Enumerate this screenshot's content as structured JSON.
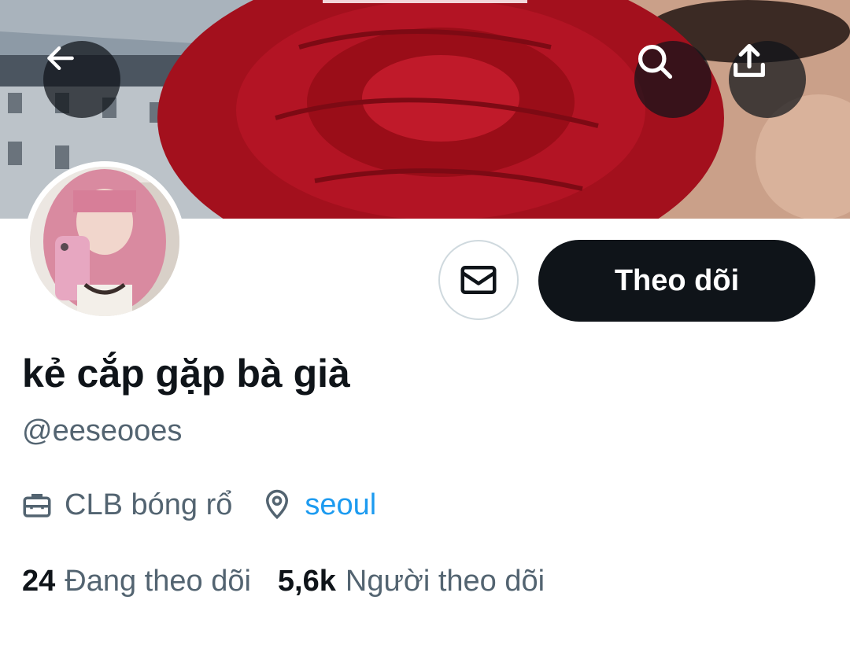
{
  "header": {
    "back_icon": "arrow-left-icon",
    "search_icon": "search-icon",
    "share_icon": "share-icon"
  },
  "profile": {
    "display_name": "kẻ cắp gặp bà già",
    "handle": "@eeseooes",
    "follow_label": "Theo dõi",
    "message_icon": "envelope-icon",
    "category": "CLB bóng rổ",
    "location": "seoul",
    "following_count": "24",
    "following_label": "Đang theo dõi",
    "followers_count": "5,6k",
    "followers_label": "Người theo dõi"
  },
  "colors": {
    "accent": "#1d9bf0",
    "primary_text": "#0f1419",
    "secondary_text": "#536471",
    "button_dark": "#0f1419"
  }
}
